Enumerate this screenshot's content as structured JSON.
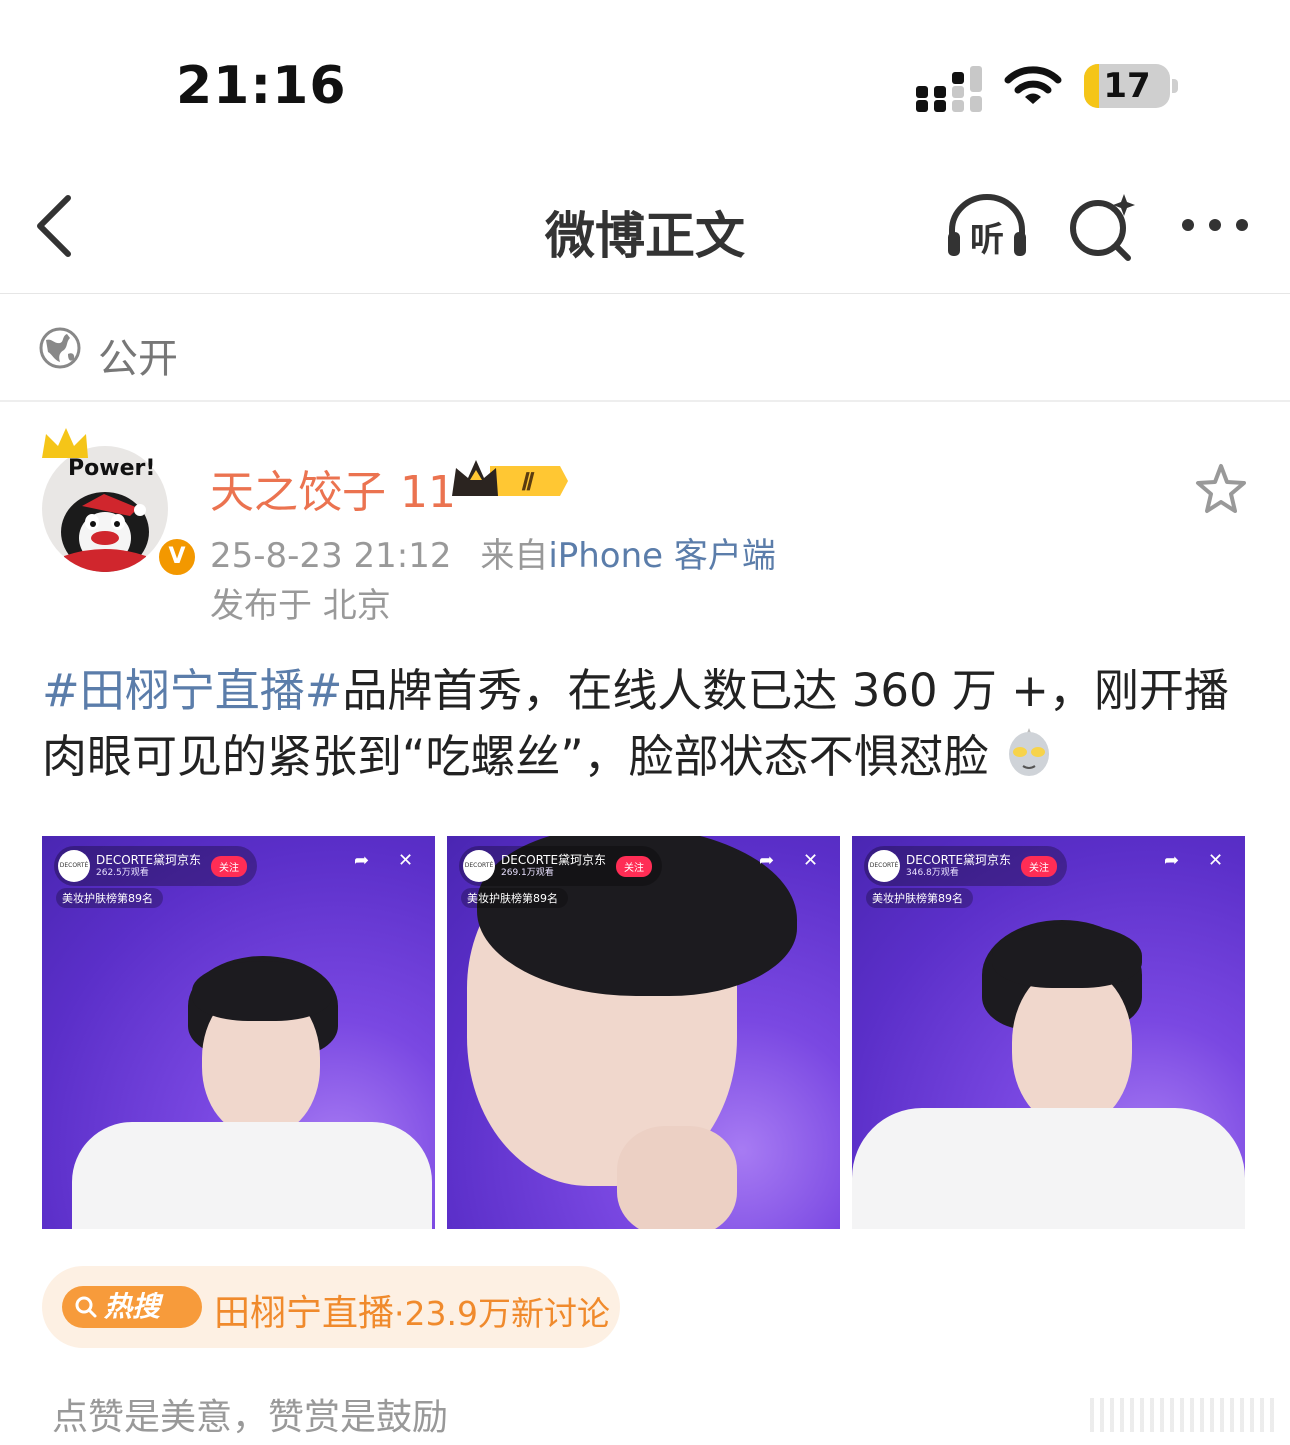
{
  "status_bar": {
    "time": "21:16",
    "battery": "17",
    "battery_level": 0.17
  },
  "nav": {
    "title": "微博正文",
    "listen_label": "听"
  },
  "visibility": {
    "label": "公开"
  },
  "author": {
    "avatar_caption": "Power!",
    "verified_mark": "V",
    "name": "天之饺子 11",
    "vip_level": "Ⅱ",
    "timestamp": "25-8-23 21:12",
    "source_prefix": "来自",
    "source_client": "iPhone 客户端",
    "location": "发布于 北京"
  },
  "post": {
    "topic": "#田栩宁直播#",
    "text": "品牌首秀，在线人数已达 360 万 +，刚开播肉眼可见的紧张到“吃螺丝”，脸部状态不惧怼脸"
  },
  "images": [
    {
      "shop": "DECORTE黛珂京东",
      "views": "262.5万观看",
      "follow": "关注",
      "rank": "美妆护肤榜第89名",
      "logo": "DECORTÉ"
    },
    {
      "shop": "DECORTE黛珂京东",
      "views": "269.1万观看",
      "follow": "关注",
      "rank": "美妆护肤榜第89名",
      "logo": "DECORTÉ"
    },
    {
      "shop": "DECORTE黛珂京东",
      "views": "346.8万观看",
      "follow": "关注",
      "rank": "美妆护肤榜第89名",
      "logo": "DECORTÉ"
    }
  ],
  "hot_search": {
    "badge": "热搜",
    "topic": "田栩宁直播",
    "count": "·23.9万新讨论"
  },
  "reward": {
    "text": "点赞是美意，赞赏是鼓励"
  },
  "colors": {
    "name": "#eb7350",
    "topic": "#5b7daa",
    "hot": "#f08a2c",
    "hot_badge": "#f79b3b",
    "live_bg": "#6d3fd4"
  }
}
